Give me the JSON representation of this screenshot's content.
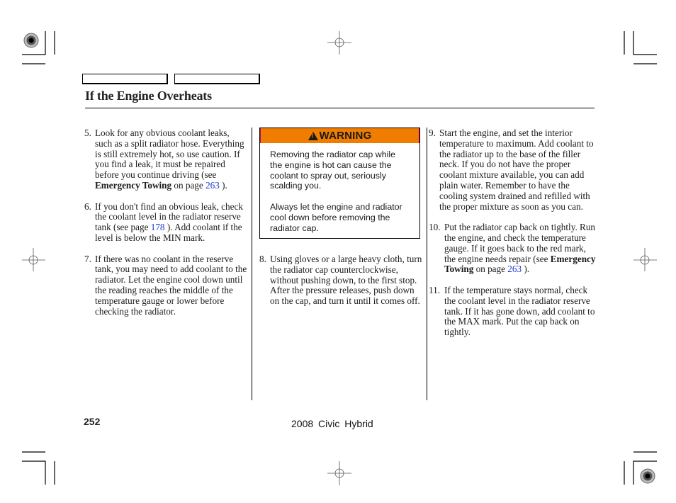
{
  "header": {
    "tabs": [
      "",
      ""
    ],
    "title": "If the Engine Overheats"
  },
  "columns": {
    "left": [
      {
        "num": "5.",
        "parts": [
          {
            "t": "Look for any obvious coolant leaks, such as a split radiator hose. Everything is still extremely hot, so use caution. If you find a leak, it must be repaired before you continue driving (see "
          },
          {
            "b": "Emergency Towing"
          },
          {
            "t": " on page "
          },
          {
            "link": "263"
          },
          {
            "t": " )."
          }
        ]
      },
      {
        "num": "6.",
        "parts": [
          {
            "t": "If you don't find an obvious leak, check the coolant level in the radiator reserve tank (see page "
          },
          {
            "link": "178"
          },
          {
            "t": " ). Add coolant if the level is below the MIN mark."
          }
        ]
      },
      {
        "num": "7.",
        "parts": [
          {
            "t": "If there was no coolant in the reserve tank, you may need to add coolant to the radiator. Let the engine cool down until the reading reaches the middle of the temperature gauge or lower before checking the radiator."
          }
        ]
      }
    ],
    "middle": [
      {
        "num": "8.",
        "parts": [
          {
            "t": "Using gloves or a large heavy cloth, turn the radiator cap counterclockwise, without pushing down, to the first stop. After the pressure releases, push down on the cap, and turn it until it comes off."
          }
        ]
      }
    ],
    "right": [
      {
        "num": "9.",
        "parts": [
          {
            "t": "Start the engine, and set the interior temperature to maximum. Add coolant to the radiator up to the base of the filler neck. If you do not have the proper coolant mixture available, you can add plain water. Remember to have the cooling system drained and refilled with the proper mixture as soon as you can."
          }
        ]
      },
      {
        "num": "10.",
        "parts": [
          {
            "t": "Put the radiator cap back on tightly. Run the engine, and check the temperature gauge. If it goes back to the red mark, the engine needs repair (see "
          },
          {
            "b": "Emergency Towing"
          },
          {
            "t": " on page "
          },
          {
            "link": "263"
          },
          {
            "t": " )."
          }
        ]
      },
      {
        "num": "11.",
        "parts": [
          {
            "t": "If the temperature stays normal, check the coolant level in the radiator reserve tank. If it has gone down, add coolant to the MAX mark. Put the cap back on tightly."
          }
        ]
      }
    ]
  },
  "warning": {
    "icon": "warning-triangle-icon",
    "label": "WARNING",
    "color": "#f07d00",
    "paragraphs": [
      "Removing the radiator cap while the engine is hot can cause the coolant to spray out, seriously scalding you.",
      "Always let the engine and radiator cool down before removing the radiator cap."
    ]
  },
  "footer": {
    "page_number": "252",
    "model": "2008  Civic  Hybrid"
  },
  "colors": {
    "link": "#1a3cc8",
    "warning_bg": "#f07d00"
  }
}
